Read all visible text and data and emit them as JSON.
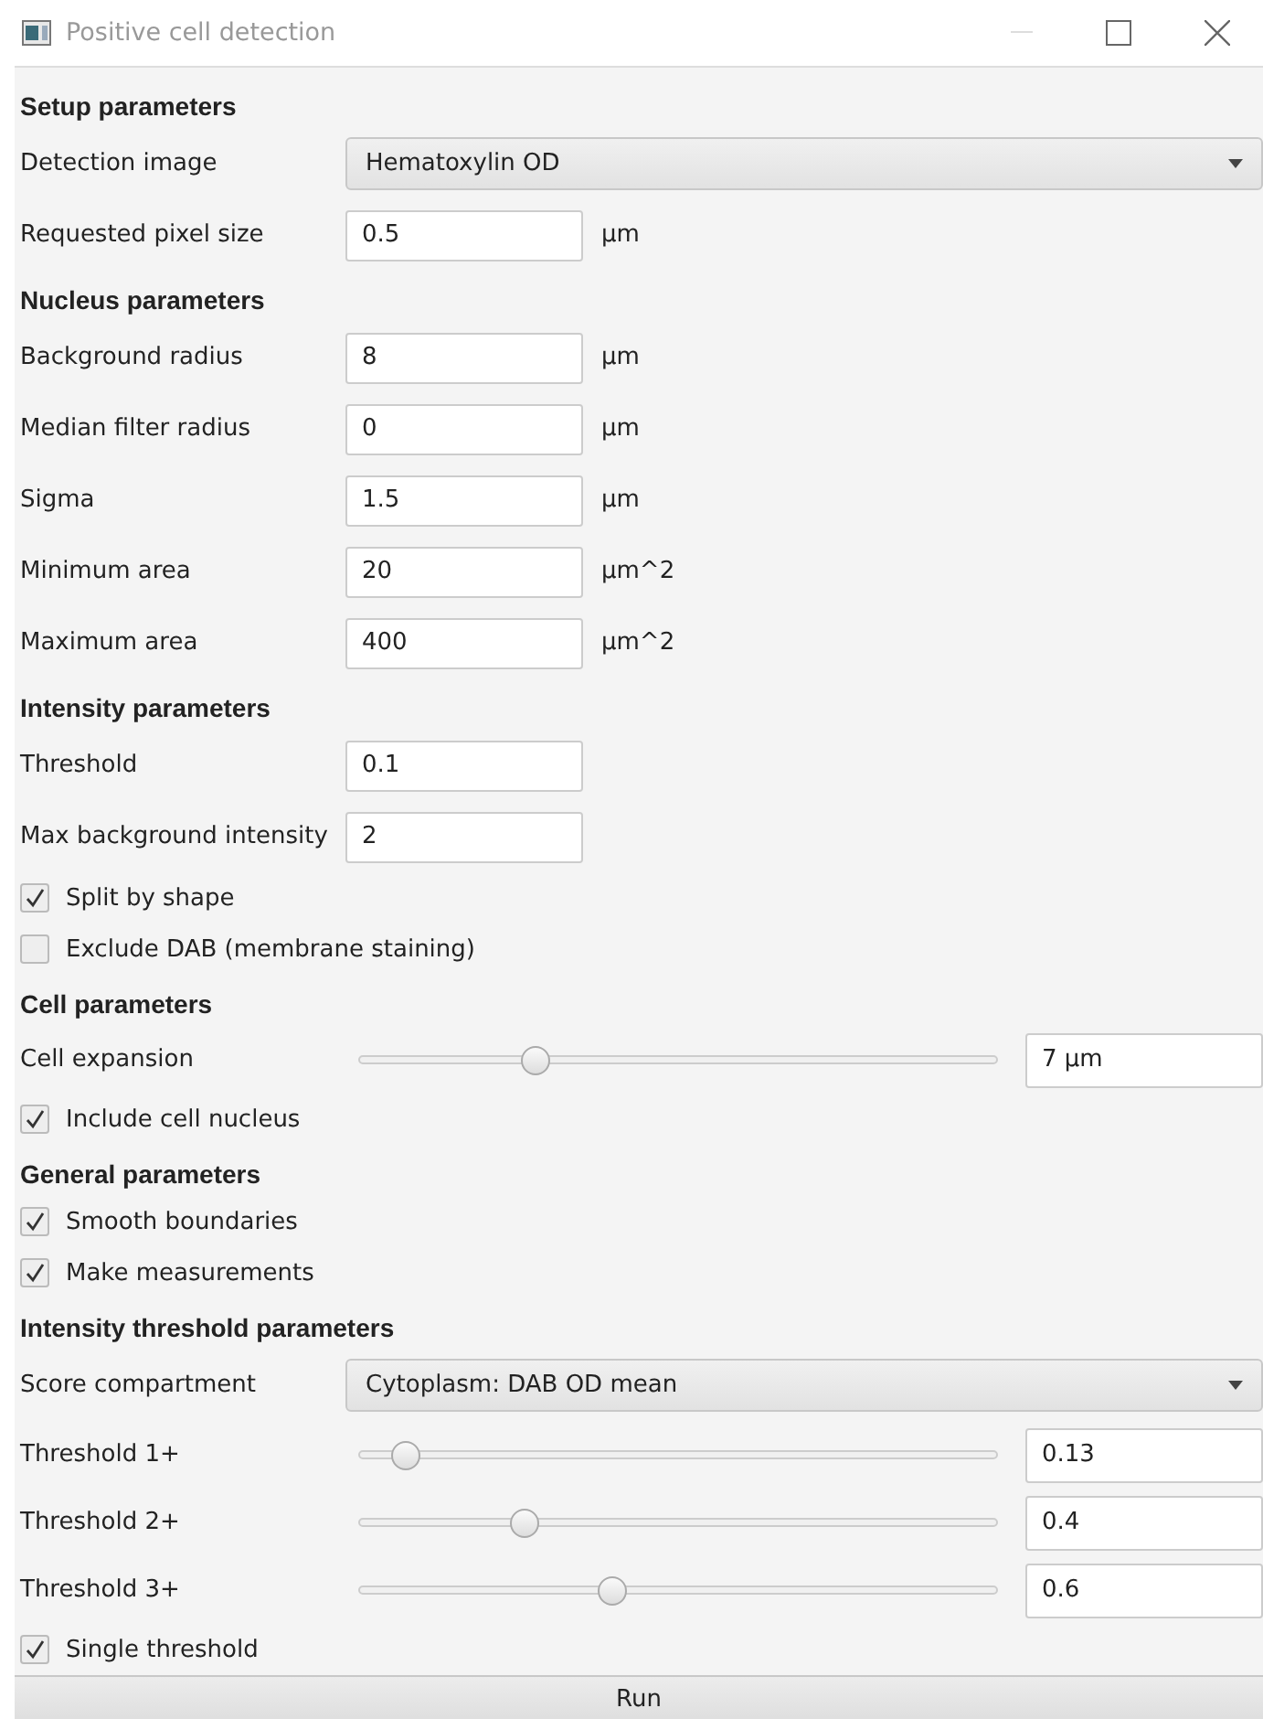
{
  "window": {
    "title": "Positive cell detection"
  },
  "sections": [
    {
      "heading": "Setup parameters",
      "rows": [
        {
          "kind": "dropdown",
          "label": "Detection image",
          "value": "Hematoxylin OD"
        },
        {
          "kind": "field",
          "label": "Requested pixel size",
          "value": "0.5",
          "unit": "µm"
        }
      ]
    },
    {
      "heading": "Nucleus parameters",
      "rows": [
        {
          "kind": "field",
          "label": "Background radius",
          "value": "8",
          "unit": "µm"
        },
        {
          "kind": "field",
          "label": "Median filter radius",
          "value": "0",
          "unit": "µm"
        },
        {
          "kind": "field",
          "label": "Sigma",
          "value": "1.5",
          "unit": "µm"
        },
        {
          "kind": "field",
          "label": "Minimum area",
          "value": "20",
          "unit": "µm^2"
        },
        {
          "kind": "field",
          "label": "Maximum area",
          "value": "400",
          "unit": "µm^2"
        }
      ]
    },
    {
      "heading": "Intensity parameters",
      "rows": [
        {
          "kind": "field",
          "label": "Threshold",
          "value": "0.1"
        },
        {
          "kind": "field",
          "label": "Max background intensity",
          "value": "2"
        },
        {
          "kind": "checkbox",
          "label": "Split by shape",
          "checked": true
        },
        {
          "kind": "checkbox",
          "label": "Exclude DAB (membrane staining)",
          "checked": false
        }
      ]
    },
    {
      "heading": "Cell parameters",
      "rows": [
        {
          "kind": "slider",
          "label": "Cell expansion",
          "level": 0.285,
          "value": "7 µm"
        },
        {
          "kind": "checkbox",
          "label": "Include cell nucleus",
          "checked": true
        }
      ]
    },
    {
      "heading": "General parameters",
      "rows": [
        {
          "kind": "checkbox",
          "label": "Smooth boundaries",
          "checked": true
        },
        {
          "kind": "checkbox",
          "label": "Make measurements",
          "checked": true
        }
      ]
    },
    {
      "heading": "Intensity threshold parameters",
      "rows": [
        {
          "kind": "dropdown",
          "label": "Score compartment",
          "value": "Cytoplasm: DAB OD mean"
        },
        {
          "kind": "slider",
          "label": "Threshold 1+",
          "level": 0.09,
          "value": "0.13"
        },
        {
          "kind": "slider",
          "label": "Threshold 2+",
          "level": 0.27,
          "value": "0.4"
        },
        {
          "kind": "slider",
          "label": "Threshold 3+",
          "level": 0.4,
          "value": "0.6"
        },
        {
          "kind": "checkbox",
          "label": "Single threshold",
          "checked": true
        }
      ]
    }
  ],
  "run_button": "Run"
}
